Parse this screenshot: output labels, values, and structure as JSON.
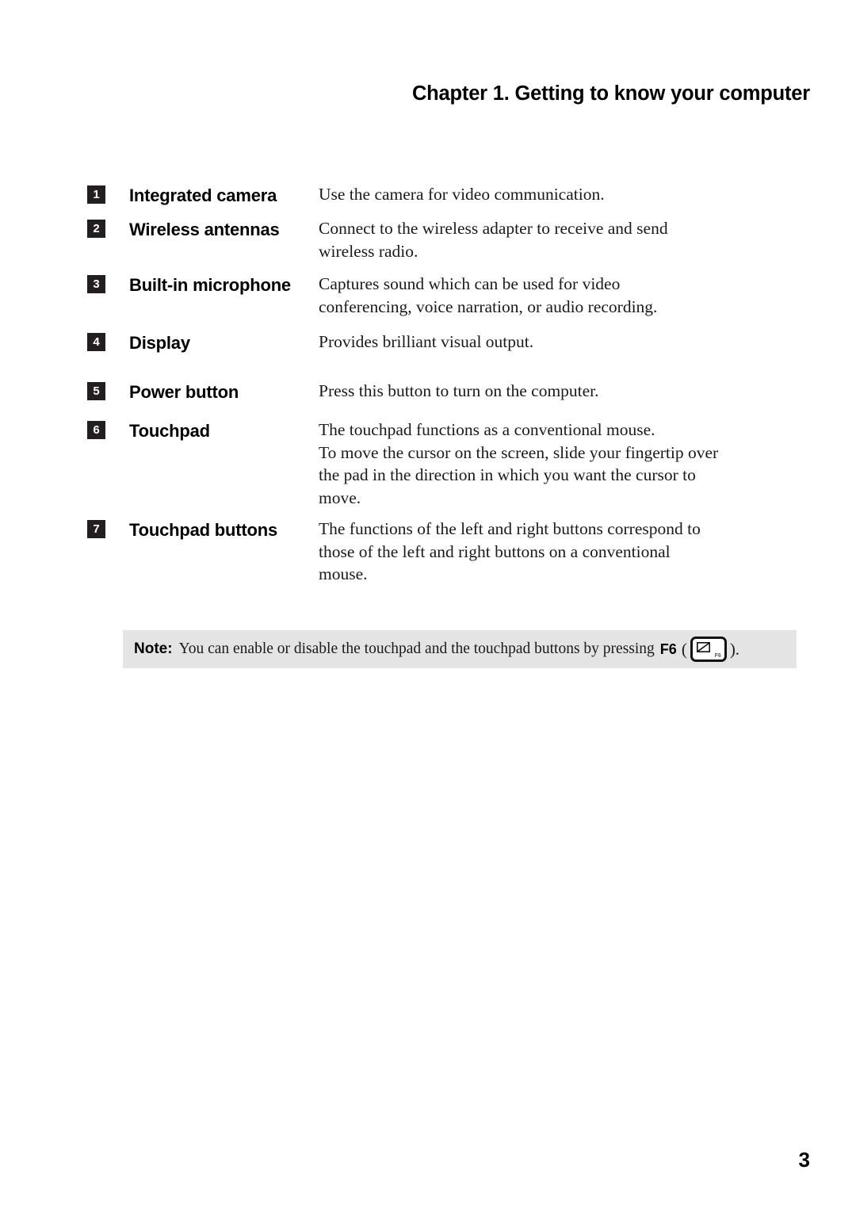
{
  "header": {
    "title": "Chapter 1. Getting to know your computer"
  },
  "features": [
    {
      "number": "1",
      "label": "Integrated camera",
      "description_lines": [
        "Use the camera for video communication."
      ]
    },
    {
      "number": "2",
      "label": "Wireless antennas",
      "description_lines": [
        "Connect to the wireless adapter to receive and send",
        "wireless radio."
      ]
    },
    {
      "number": "3",
      "label": "Built-in microphone",
      "description_lines": [
        "Captures sound which can be used for video",
        "conferencing, voice narration, or audio recording."
      ]
    },
    {
      "number": "4",
      "label": "Display",
      "description_lines": [
        "Provides brilliant visual output."
      ]
    },
    {
      "number": "5",
      "label": "Power button",
      "description_lines": [
        "Press this button to turn on the computer."
      ]
    },
    {
      "number": "6",
      "label": "Touchpad",
      "description_lines": [
        "The touchpad functions as a conventional mouse.",
        "To move the cursor on the screen, slide your fingertip over",
        "the pad in the direction in which you want the cursor to",
        "move."
      ]
    },
    {
      "number": "7",
      "label": "Touchpad buttons",
      "description_lines": [
        "The functions of the left and right buttons correspond to",
        "those of the left and right buttons on a conventional",
        "mouse."
      ]
    }
  ],
  "note": {
    "label": "Note:",
    "text_before": "You can enable or disable the touchpad and the touchpad buttons by pressing",
    "key_name": "F6",
    "paren_open": "(",
    "paren_close": ").",
    "keycap_function_label": "F6"
  },
  "footer": {
    "page_number": "3"
  },
  "colors": {
    "page_background": "#ffffff",
    "marker_background": "#231f20",
    "marker_text": "#ffffff",
    "note_background": "#e4e4e4",
    "body_text": "#1a1a1a",
    "heading_text": "#000000"
  }
}
